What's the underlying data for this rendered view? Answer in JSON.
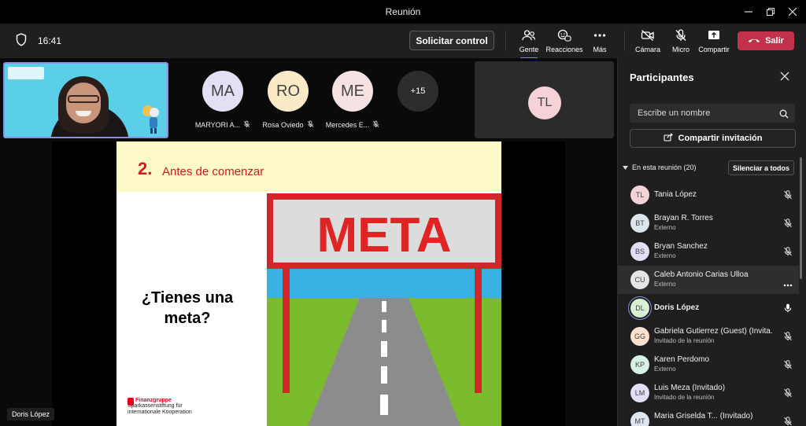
{
  "window": {
    "title": "Reunión"
  },
  "toolbar": {
    "time": "16:41",
    "request_control": "Solicitar control",
    "people_label": "Gente",
    "reactions_label": "Reacciones",
    "more_label": "Más",
    "camera_label": "Cámara",
    "mic_label": "Micro",
    "share_label": "Compartir",
    "leave_label": "Salir"
  },
  "gallery": {
    "participants": [
      {
        "initials": "MA",
        "name": "MARYORI A...",
        "color": "#e4dff5"
      },
      {
        "initials": "RO",
        "name": "Rosa Oviedo",
        "color": "#faebc6"
      },
      {
        "initials": "ME",
        "name": "Mercedes E...",
        "color": "#f6e1e3"
      }
    ],
    "overflow_count": "+15",
    "pinned_initials": "TL"
  },
  "slide": {
    "number": "2.",
    "heading": "Antes de comenzar",
    "sign_text": "META",
    "question": "¿Tienes una meta?",
    "logo_brand": "Finanzgruppe",
    "logo_line1": "Sparkassenstiftung für",
    "logo_line2": "internationale Kooperation"
  },
  "presenter_tag": "Doris López",
  "panel": {
    "title": "Participantes",
    "search_placeholder": "Escribe un nombre",
    "invite_label": "Compartir invitación",
    "section_label": "En esta reunión (20)",
    "mute_all_label": "Silenciar a todos",
    "participants": [
      {
        "initials": "TL",
        "name": "Tania López",
        "sub": "",
        "color": "#f4d2d7"
      },
      {
        "initials": "BT",
        "name": "Brayan R. Torres",
        "sub": "Externo",
        "color": "#dce6ec"
      },
      {
        "initials": "BS",
        "name": "Bryan Sanchez",
        "sub": "Externo",
        "color": "#e0dff5"
      },
      {
        "initials": "CU",
        "name": "Caleb Antonio Carias Ulloa",
        "sub": "Externo",
        "color": "#e5e5e5"
      },
      {
        "initials": "DL",
        "name": "Doris López",
        "sub": "",
        "color": "#d8f0d3"
      },
      {
        "initials": "GG",
        "name": "Gabriela Gutierrez (Guest) (Invita...",
        "sub": "Invitado de la reunión",
        "color": "#fde0cd"
      },
      {
        "initials": "KP",
        "name": "Karen Perdomo",
        "sub": "Externo",
        "color": "#d6f2e4"
      },
      {
        "initials": "LM",
        "name": "Luis Meza (Invitado)",
        "sub": "Invitado de la reunión",
        "color": "#e2e0f6"
      },
      {
        "initials": "MT",
        "name": "Maria Griselda T...  (Invitado)",
        "sub": "",
        "color": "#dbe6f1"
      }
    ]
  }
}
